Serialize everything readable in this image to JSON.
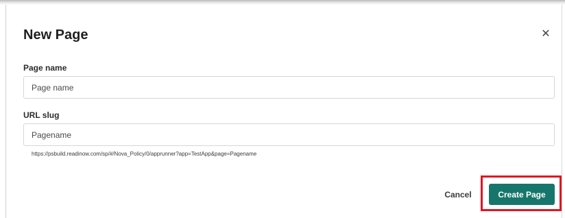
{
  "dialog": {
    "title": "New Page",
    "close_icon": "close-icon",
    "close_glyph": "✕"
  },
  "fields": {
    "page_name": {
      "label": "Page name",
      "value": "",
      "placeholder": "Page name"
    },
    "url_slug": {
      "label": "URL slug",
      "value": "",
      "placeholder": "Pagename",
      "hint": "https://psbuild.readinow.com/sp/#/Nova_Policy/0/apprunner?app=TestApp&page=Pagename"
    }
  },
  "actions": {
    "cancel_label": "Cancel",
    "create_label": "Create Page"
  },
  "colors": {
    "primary": "#17766b",
    "highlight": "#e0141e"
  }
}
